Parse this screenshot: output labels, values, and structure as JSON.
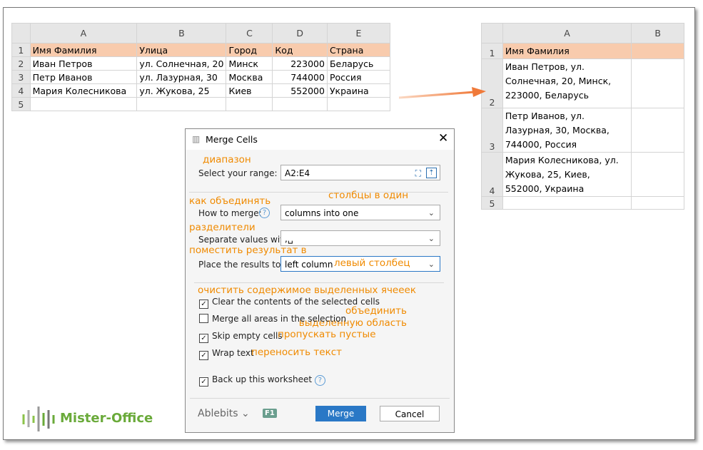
{
  "left_sheet": {
    "columns": [
      "A",
      "B",
      "C",
      "D",
      "E"
    ],
    "rows": [
      {
        "n": "1",
        "cells": [
          "Имя Фамилия",
          "Улица",
          "Город",
          "Код",
          "Страна"
        ]
      },
      {
        "n": "2",
        "cells": [
          "Иван Петров",
          "ул. Солнечная, 20",
          "Минск",
          "223000",
          "Беларусь"
        ]
      },
      {
        "n": "3",
        "cells": [
          "Петр Иванов",
          "ул. Лазурная, 30",
          "Москва",
          "744000",
          "Россия"
        ]
      },
      {
        "n": "4",
        "cells": [
          "Мария Колесникова",
          "ул. Жукова, 25",
          "Киев",
          "552000",
          "Украина"
        ]
      },
      {
        "n": "5",
        "cells": [
          "",
          "",
          "",
          "",
          ""
        ]
      }
    ]
  },
  "right_sheet": {
    "columns": [
      "A",
      "B"
    ],
    "rows": [
      {
        "n": "1",
        "a": "Имя Фамилия"
      },
      {
        "n": "2",
        "a": "Иван Петров, ул. Солнечная, 20, Минск, 223000, Беларусь"
      },
      {
        "n": "3",
        "a": "Петр Иванов, ул. Лазурная, 30, Москва, 744000, Россия"
      },
      {
        "n": "4",
        "a": "Мария Колесникова, ул. Жукова, 25, Киев, 552000, Украина"
      },
      {
        "n": "5",
        "a": ""
      }
    ]
  },
  "dialog": {
    "title": "Merge Cells",
    "range_label": "Select your range:",
    "range_value": "A2:E4",
    "how_label": "How to merge:",
    "how_value": "columns into one",
    "sep_label": "Separate values with:",
    "sep_value": ",␣",
    "place_label": "Place the results to:",
    "place_value": "left column",
    "checks": [
      {
        "label": "Clear the contents of the selected cells",
        "checked": true
      },
      {
        "label": "Merge all areas in the selection",
        "checked": false
      },
      {
        "label": "Skip empty cells",
        "checked": true
      },
      {
        "label": "Wrap text",
        "checked": true
      },
      {
        "label": "Back up this worksheet",
        "checked": true
      }
    ],
    "brand": "Ablebits",
    "f1": "F1",
    "merge": "Merge",
    "cancel": "Cancel"
  },
  "annotations": {
    "range": "диапазон",
    "how": "как объединять",
    "how_value": "столбцы в один",
    "sep": "разделители",
    "place": "поместить результат в",
    "place_value": "левый столбец",
    "clear": "очистить содержимое выделенных ячееек",
    "merge_all": "объединить выделенную область",
    "skip": "пропускать пустые",
    "wrap": "переносить текст"
  },
  "logo": "Mister-Office",
  "colors": {
    "header_fill": "#f8cbad",
    "annotation": "#f08a00",
    "accent": "#2a78c6",
    "logo": "#6aaa3a"
  }
}
